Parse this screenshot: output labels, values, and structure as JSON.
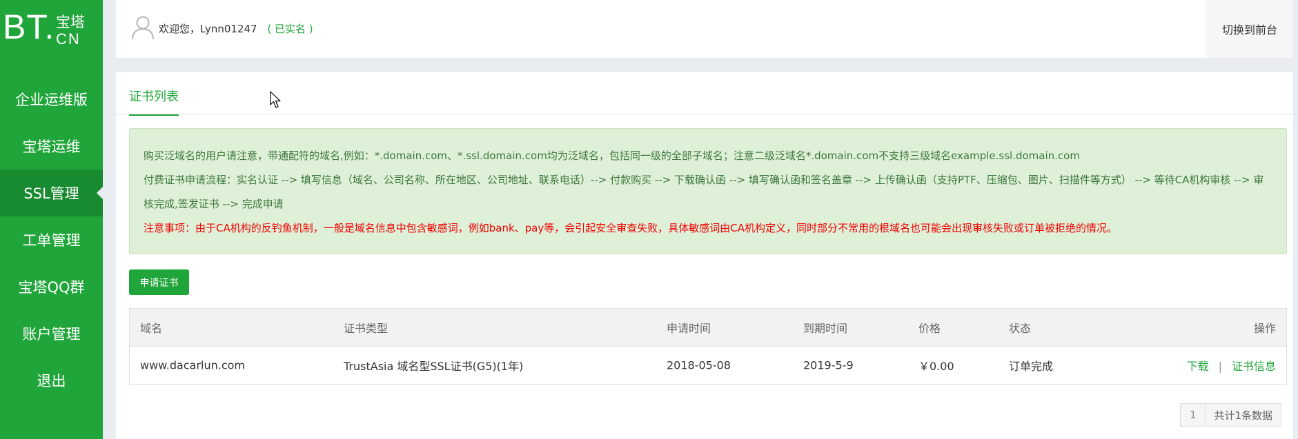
{
  "brand": {
    "logo_main": "BT.",
    "logo_top": "宝塔",
    "logo_bottom": "CN",
    "accent_color": "#20a53a"
  },
  "sidebar": {
    "items": [
      {
        "label": "企业运维版",
        "active": false
      },
      {
        "label": "宝塔运维",
        "active": false
      },
      {
        "label": "SSL管理",
        "active": true
      },
      {
        "label": "工单管理",
        "active": false
      },
      {
        "label": "宝塔QQ群",
        "active": false
      },
      {
        "label": "账户管理",
        "active": false
      },
      {
        "label": "退出",
        "active": false
      }
    ]
  },
  "header": {
    "welcome_text": "欢迎您，Lynn01247",
    "verified_text": "( 已实名 )",
    "switch_label": "切换到前台"
  },
  "tabs": [
    {
      "label": "证书列表",
      "active": true
    }
  ],
  "notice": {
    "line1": "购买泛域名的用户请注意，带通配符的域名,例如：*.domain.com、*.ssl.domain.com均为泛域名，包括同一级的全部子域名；注意二级泛域名*.domain.com不支持三级域名example.ssl.domain.com",
    "line2": "付费证书申请流程：实名认证 --> 填写信息（域名、公司名称、所在地区、公司地址、联系电话）--> 付款购买 --> 下载确认函 --> 填写确认函和签名盖章 --> 上传确认函（支持PTF、压缩包、图片、扫描件等方式） --> 等待CA机构审核 --> 审核完成,签发证书 --> 完成申请",
    "warning": "注意事项：由于CA机构的反钓鱼机制，一般是域名信息中包含敏感词，例如bank、pay等，会引起安全审查失败，具体敏感词由CA机构定义，同时部分不常用的根域名也可能会出现审核失败或订单被拒绝的情况。"
  },
  "apply_button": "申请证书",
  "table": {
    "headers": {
      "domain": "域名",
      "cert_type": "证书类型",
      "apply_time": "申请时间",
      "expire_time": "到期时间",
      "price": "价格",
      "status": "状态",
      "actions": "操作"
    },
    "rows": [
      {
        "domain": "www.dacarlun.com",
        "cert_type": "TrustAsia 域名型SSL证书(G5)(1年)",
        "apply_time": "2018-05-08",
        "expire_time": "2019-5-9",
        "price": "￥0.00",
        "status": "订单完成",
        "download": "下载",
        "separator": "|",
        "cert_info": "证书信息"
      }
    ]
  },
  "pagination": {
    "current_page": "1",
    "total_text": "共计1条数据"
  }
}
